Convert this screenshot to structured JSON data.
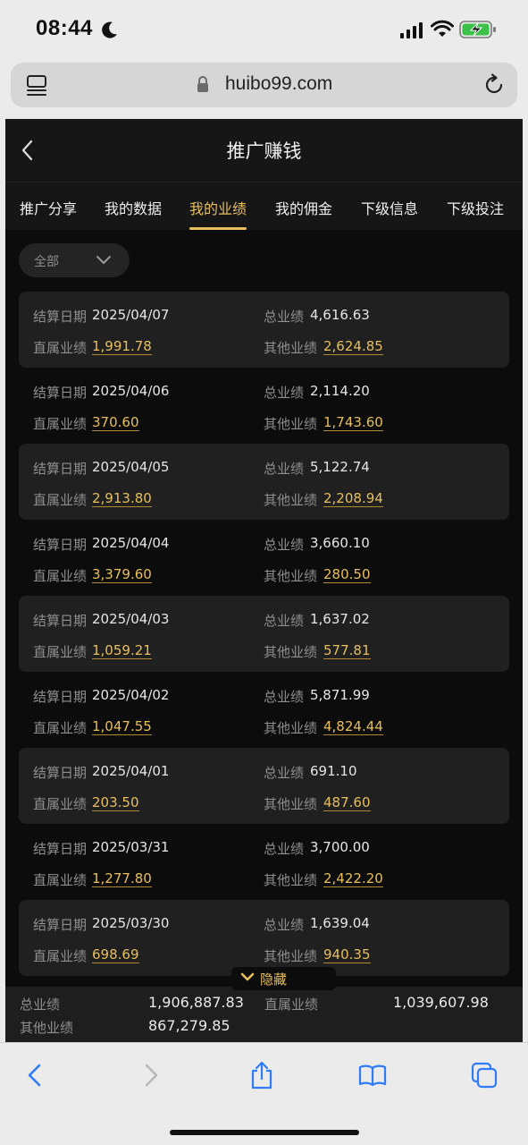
{
  "status": {
    "time": "08:44"
  },
  "browser": {
    "url": "huibo99.com"
  },
  "header": {
    "title": "推广赚钱"
  },
  "tabs": [
    {
      "label": "推广分享",
      "active": false
    },
    {
      "label": "我的数据",
      "active": false
    },
    {
      "label": "我的业绩",
      "active": true
    },
    {
      "label": "我的佣金",
      "active": false
    },
    {
      "label": "下级信息",
      "active": false
    },
    {
      "label": "下级投注",
      "active": false
    }
  ],
  "filter": {
    "label": "全部"
  },
  "labels": {
    "settle_date": "结算日期",
    "total": "总业绩",
    "direct": "直属业绩",
    "other": "其他业绩"
  },
  "rows": [
    {
      "date": "2025/04/07",
      "total": "4,616.63",
      "direct": "1,991.78",
      "other": "2,624.85"
    },
    {
      "date": "2025/04/06",
      "total": "2,114.20",
      "direct": "370.60",
      "other": "1,743.60"
    },
    {
      "date": "2025/04/05",
      "total": "5,122.74",
      "direct": "2,913.80",
      "other": "2,208.94"
    },
    {
      "date": "2025/04/04",
      "total": "3,660.10",
      "direct": "3,379.60",
      "other": "280.50"
    },
    {
      "date": "2025/04/03",
      "total": "1,637.02",
      "direct": "1,059.21",
      "other": "577.81"
    },
    {
      "date": "2025/04/02",
      "total": "5,871.99",
      "direct": "1,047.55",
      "other": "4,824.44"
    },
    {
      "date": "2025/04/01",
      "total": "691.10",
      "direct": "203.50",
      "other": "487.60"
    },
    {
      "date": "2025/03/31",
      "total": "3,700.00",
      "direct": "1,277.80",
      "other": "2,422.20"
    },
    {
      "date": "2025/03/30",
      "total": "1,639.04",
      "direct": "698.69",
      "other": "940.35"
    }
  ],
  "hide_toggle": {
    "label": "隐藏"
  },
  "summary": {
    "total_label": "总业绩",
    "total_value": "1,906,887.83",
    "direct_label": "直属业绩",
    "direct_value": "1,039,607.98",
    "other_label": "其他业绩",
    "other_value": "867,279.85"
  },
  "colors": {
    "accent": "#e7bf5e",
    "background": "#0c0c0c",
    "card": "#202020",
    "ios_blue": "#2f7cf6"
  }
}
